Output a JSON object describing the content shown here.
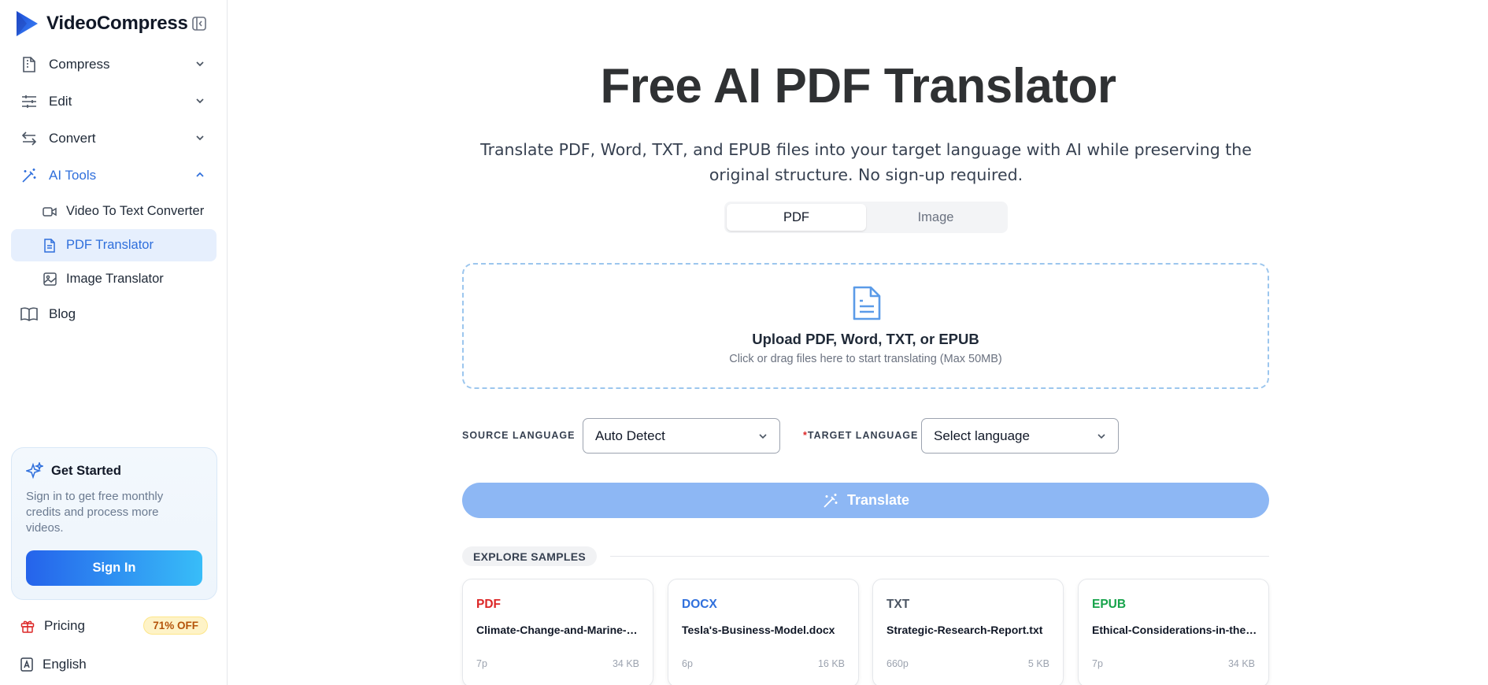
{
  "app": {
    "name": "VideoCompress"
  },
  "nav": [
    {
      "label": "Compress",
      "icon": "file-zip-icon"
    },
    {
      "label": "Edit",
      "icon": "sliders-icon"
    },
    {
      "label": "Convert",
      "icon": "arrows-swap-icon"
    },
    {
      "label": "AI Tools",
      "icon": "magic-wand-icon"
    }
  ],
  "ai_tools": [
    {
      "label": "Video To Text Converter",
      "icon": "video-icon"
    },
    {
      "label": "PDF Translator",
      "icon": "document-icon"
    },
    {
      "label": "Image Translator",
      "icon": "image-icon"
    }
  ],
  "blog": {
    "label": "Blog",
    "icon": "book-icon"
  },
  "cta": {
    "title": "Get Started",
    "text": "Sign in to get free monthly credits and process more videos.",
    "button": "Sign In"
  },
  "pricing": {
    "label": "Pricing",
    "badge": "71% OFF"
  },
  "language": {
    "label": "English"
  },
  "hero": {
    "title": "Free AI PDF Translator",
    "subtitle": "Translate PDF, Word, TXT, and EPUB files into your target language with AI while preserving the original structure. No sign-up required."
  },
  "tabs": {
    "pdf": "PDF",
    "image": "Image",
    "selected": "PDF"
  },
  "upload": {
    "title": "Upload PDF, Word, TXT, or EPUB",
    "subtitle": "Click or drag files here to start translating (Max 50MB)"
  },
  "source": {
    "label": "SOURCE LANGUAGE",
    "value": "Auto Detect"
  },
  "target": {
    "required": "*",
    "label": "TARGET LANGUAGE",
    "value": "Select language"
  },
  "translate": {
    "label": "Translate"
  },
  "samples": {
    "title": "EXPLORE SAMPLES",
    "items": [
      {
        "type": "PDF",
        "color": "#dc2626",
        "name": "Climate-Change-and-Marine-Ecosystems.pdf",
        "pages": "7p",
        "size": "34 KB"
      },
      {
        "type": "DOCX",
        "color": "#2f6fdc",
        "name": "Tesla's-Business-Model.docx",
        "pages": "6p",
        "size": "16 KB"
      },
      {
        "type": "TXT",
        "color": "#4b5563",
        "name": "Strategic-Research-Report.txt",
        "pages": "660p",
        "size": "5 KB"
      },
      {
        "type": "EPUB",
        "color": "#16a34a",
        "name": "Ethical-Considerations-in-the-Age-of-AI.epub",
        "pages": "7p",
        "size": "34 KB"
      }
    ]
  },
  "colors": {
    "accent": "#2f6fdc",
    "translate_disabled": "#8db7f4"
  }
}
